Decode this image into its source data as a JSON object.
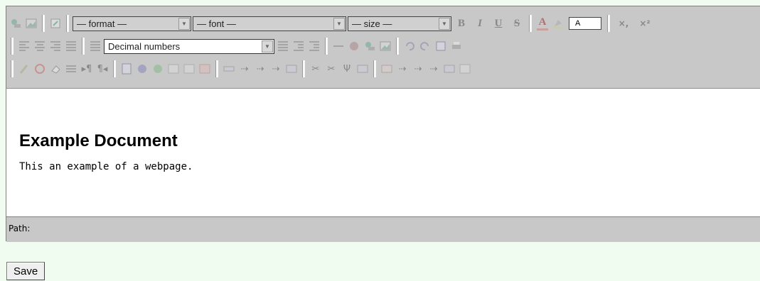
{
  "toolbar": {
    "format_select": "— format —",
    "font_select": "— font —",
    "size_select": "— size —",
    "bold": "B",
    "italic": "I",
    "underline": "U",
    "strike": "S",
    "forecolor_letter": "A",
    "color_value": "A",
    "subscript": "×,",
    "superscript": "×²",
    "list_style_select": "Decimal numbers"
  },
  "document": {
    "title": "Example Document",
    "paragraph": "This an example of a webpage."
  },
  "statusbar": {
    "path_label": "Path:"
  },
  "actions": {
    "save_label": "Save"
  }
}
